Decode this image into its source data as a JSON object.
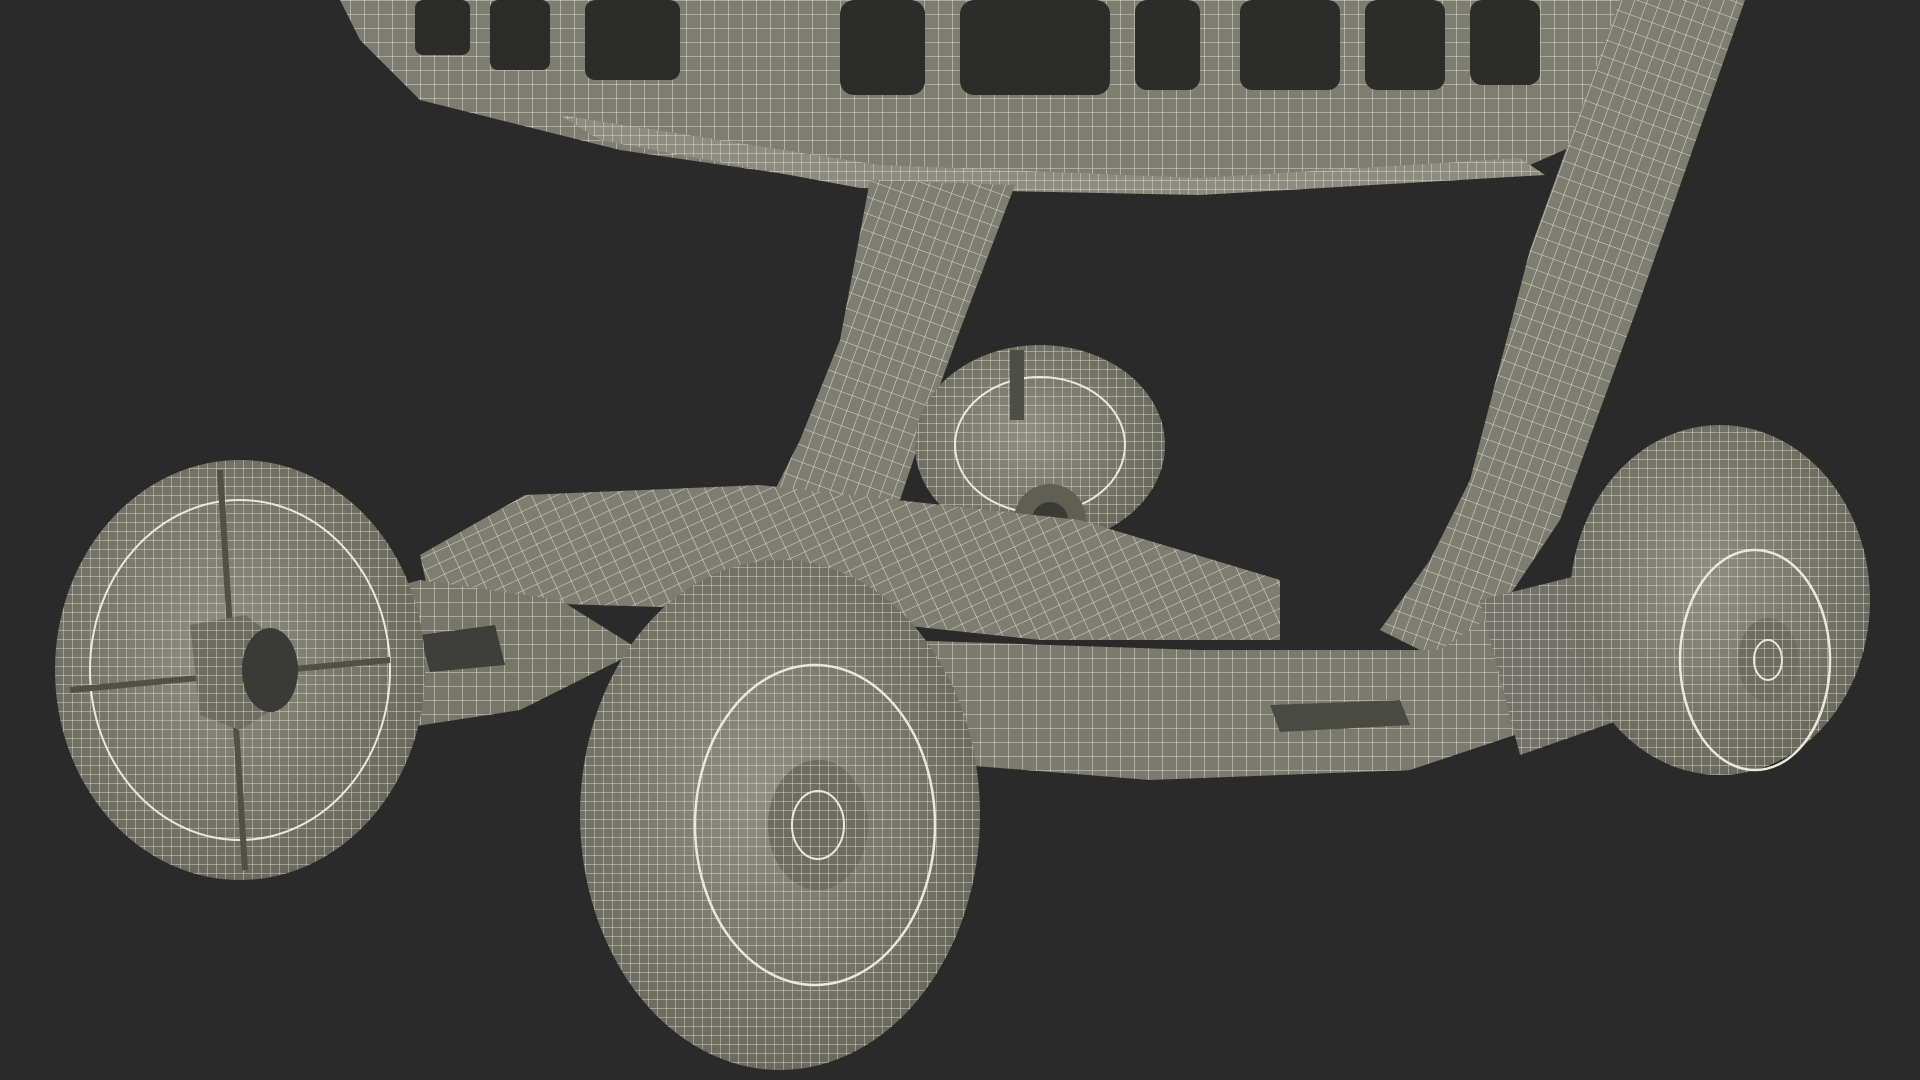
{
  "scene": {
    "subject": "wireframe-3d-render",
    "colors": {
      "background": "#2a2a2a",
      "surface": "#7d7d72",
      "surface_light": "#8c8c80",
      "surface_dark": "#5f5f56",
      "wire": "#e8e8dc",
      "inner": "#3a3a36"
    }
  }
}
